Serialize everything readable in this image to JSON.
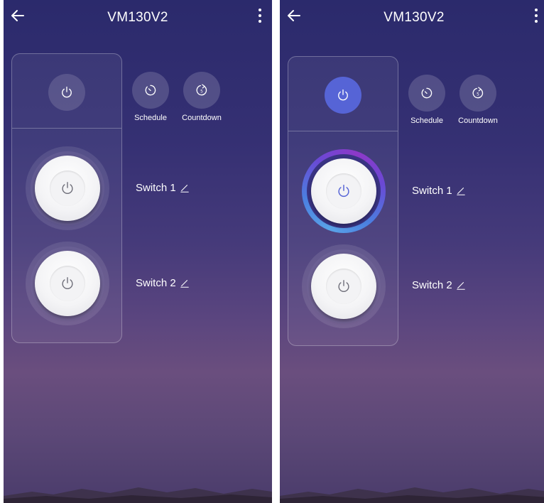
{
  "screens": [
    {
      "title": "VM130V2",
      "master_power_on": false,
      "actions": [
        {
          "label": "Schedule",
          "icon": "schedule-icon"
        },
        {
          "label": "Countdown",
          "icon": "countdown-icon"
        }
      ],
      "switches": [
        {
          "label": "Switch 1",
          "on": false
        },
        {
          "label": "Switch 2",
          "on": false
        }
      ]
    },
    {
      "title": "VM130V2",
      "master_power_on": true,
      "actions": [
        {
          "label": "Schedule",
          "icon": "schedule-icon"
        },
        {
          "label": "Countdown",
          "icon": "countdown-icon"
        }
      ],
      "switches": [
        {
          "label": "Switch 1",
          "on": true
        },
        {
          "label": "Switch 2",
          "on": false
        }
      ]
    }
  ],
  "colors": {
    "background_top": "#2b2a6c",
    "background_bottom": "#4a3c6b",
    "accent_on": "#5664d6",
    "power_icon_on": "#5664d6",
    "power_icon_off": "#6d6d78"
  }
}
